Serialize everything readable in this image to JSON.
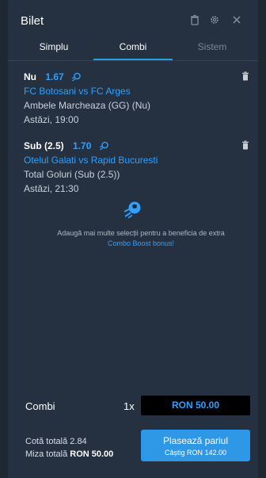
{
  "header": {
    "title": "Bilet"
  },
  "tabs": [
    {
      "label": "Simplu"
    },
    {
      "label": "Combi"
    },
    {
      "label": "Sistem"
    }
  ],
  "bets": [
    {
      "selection": "Nu",
      "odds": "1.67",
      "match": "FC Botosani vs FC Arges",
      "market": "Ambele Marcheaza (GG) (Nu)",
      "time": "Astăzi, 19:00"
    },
    {
      "selection": "Sub (2.5)",
      "odds": "1.70",
      "match": "Otelul Galati vs Rapid Bucuresti",
      "market": "Total Goluri (Sub (2.5))",
      "time": "Astăzi, 21:30"
    }
  ],
  "promo": {
    "text": "Adaugă mai multe selecții pentru a beneficia de extra",
    "link": "Combo Boost bonus!"
  },
  "combi": {
    "label": "Combi",
    "multiplier": "1x",
    "stake": "RON 50.00"
  },
  "totals": {
    "odds_label": "Cotă totală",
    "odds_value": "2.84",
    "stake_label": "Miza totală",
    "stake_value": "RON 50.00"
  },
  "place_bet": {
    "label": "Plasează pariul",
    "win": "Câștig RON 142.00"
  },
  "colors": {
    "accent": "#2ea0ff",
    "panel": "#253140",
    "button": "#2f98e6"
  }
}
